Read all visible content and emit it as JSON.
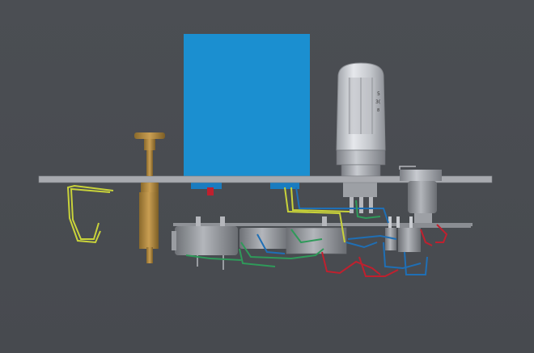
{
  "viewport": {
    "background_color": "#4a4d52",
    "model_icon": "cad-assembly-view"
  },
  "colors": {
    "chassis": "#a8aaaf",
    "transformer": "#1b8fd0",
    "tube_glass": "#c9ccd1",
    "brass": "#b08840",
    "wire_green": "#2f9a5a",
    "wire_blue": "#1f6fb5",
    "wire_red": "#c0202e",
    "wire_yellow": "#c9d33a"
  },
  "tube": {
    "label_line1": "5",
    "label_line2": "3(",
    "label_line3": "8"
  }
}
